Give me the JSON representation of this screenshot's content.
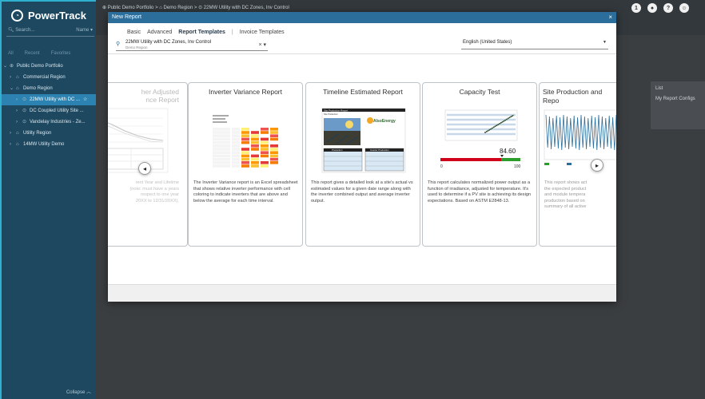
{
  "app": {
    "name": "PowerTrack"
  },
  "search": {
    "placeholder": "Search...",
    "scope": "Name"
  },
  "filters": [
    "All",
    "Recent",
    "Favorites"
  ],
  "tree": [
    {
      "label": "Public Demo Portfolio",
      "indent": 0,
      "selected": false
    },
    {
      "label": "Commercial Region",
      "indent": 1,
      "selected": false
    },
    {
      "label": "Demo Region",
      "indent": 1,
      "selected": false
    },
    {
      "label": "22MW Utility with DC ...",
      "indent": 2,
      "selected": true
    },
    {
      "label": "DC Coupled Utility Site ...",
      "indent": 2,
      "selected": false
    },
    {
      "label": "Vandelay Industries - Ze...",
      "indent": 2,
      "selected": false
    },
    {
      "label": "Utility Region",
      "indent": 1,
      "selected": false
    },
    {
      "label": "14MW Utility Demo",
      "indent": 1,
      "selected": false
    }
  ],
  "sidebar_footer": {
    "collapse_label": "Collapse"
  },
  "breadcrumb": [
    "Public Demo Portfolio",
    "Demo Region",
    "22MW Utility with DC Zones, Inv Control"
  ],
  "top_icons": [
    "notifications-icon",
    "user-icon",
    "help-icon",
    "account-icon"
  ],
  "top_icon_badge": "1",
  "right_panel": {
    "list_label": "List",
    "configs_label": "My Report Configs"
  },
  "modal": {
    "title": "New Report",
    "close_glyph": "×",
    "tabs": [
      "Basic",
      "Advanced",
      "Report Templates",
      "Invoice Templates"
    ],
    "active_tab": "Report Templates",
    "site": {
      "name": "22MW Utility with DC Zones, Inv Control",
      "region": "Demo Region"
    },
    "language": "English (United States)"
  },
  "cards": [
    {
      "title": "Weather Adjusted Performance Report",
      "title_display": "her Adjusted\nnce Report",
      "desc": "Weather-adjusted data for the Year and Lifetime of the site. Note: the report must have a years worth of data with respect to one year (1/1/20XX to 12/31/20XX).",
      "desc_display": "rent Year and Lifetime\n(note: must have a years\nrespect to one year\n20XX to 12/31/20XX)."
    },
    {
      "title": "Inverter Variance Report",
      "desc": "The Inverter Variance report is an Excel spreadsheet that shows relative inverter performance with cell coloring to indicate inverters that are above and below the average for each time interval."
    },
    {
      "title": "Timeline Estimated Report",
      "desc": "This report gives a detailed look at a site's actual vs estimated values for a given date range along with the inverter combined output and average inverter output."
    },
    {
      "title": "Capacity Test",
      "desc": "This report calculates normalized power output as a function of irradiance, adjusted for temperature. It's used to determine if a PV site is achieving its design expectations. Based on ASTM E2848-13.",
      "gauge_value": "84.60",
      "gauge_min": "0",
      "gauge_max": "100"
    },
    {
      "title": "Site Production and Expectations Report",
      "title_display": "Site Production and\nRepo",
      "desc": "This report shows actual production vs the expected production with estimated and module temperature-adjusted production based on weather data and a summary of all active alerts.",
      "desc_display": "This report shows act\nthe expected product\nand module tempera\nproduction based on\nsummary of all active"
    }
  ],
  "thumb_text": {
    "site_production_report": "Site Production Report",
    "site_production": "Site Production",
    "production": "Production",
    "inverter_production": "Inverter Production",
    "brand": "AlsoEnergy"
  }
}
